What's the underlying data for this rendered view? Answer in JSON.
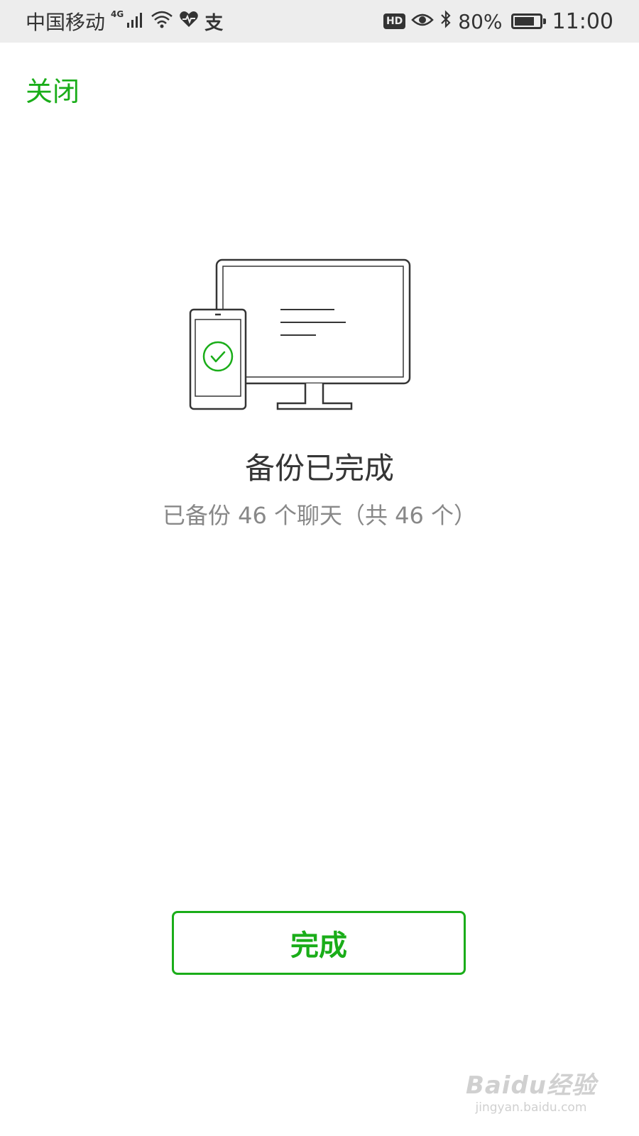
{
  "status_bar": {
    "carrier": "中国移动",
    "network_type": "4G",
    "battery_percent": "80%",
    "battery_level": 0.8,
    "time": "11:00",
    "hd_label": "HD",
    "misc_icon": "支"
  },
  "header": {
    "close_label": "关闭"
  },
  "backup": {
    "title": "备份已完成",
    "subtitle": "已备份 46 个聊天（共 46 个）"
  },
  "actions": {
    "done_label": "完成"
  },
  "watermark": {
    "logo": "Baidu经验",
    "url": "jingyan.baidu.com"
  },
  "colors": {
    "accent": "#1aad19",
    "title": "#353535",
    "subtitle": "#888888",
    "status_bar_bg": "#ededed"
  }
}
